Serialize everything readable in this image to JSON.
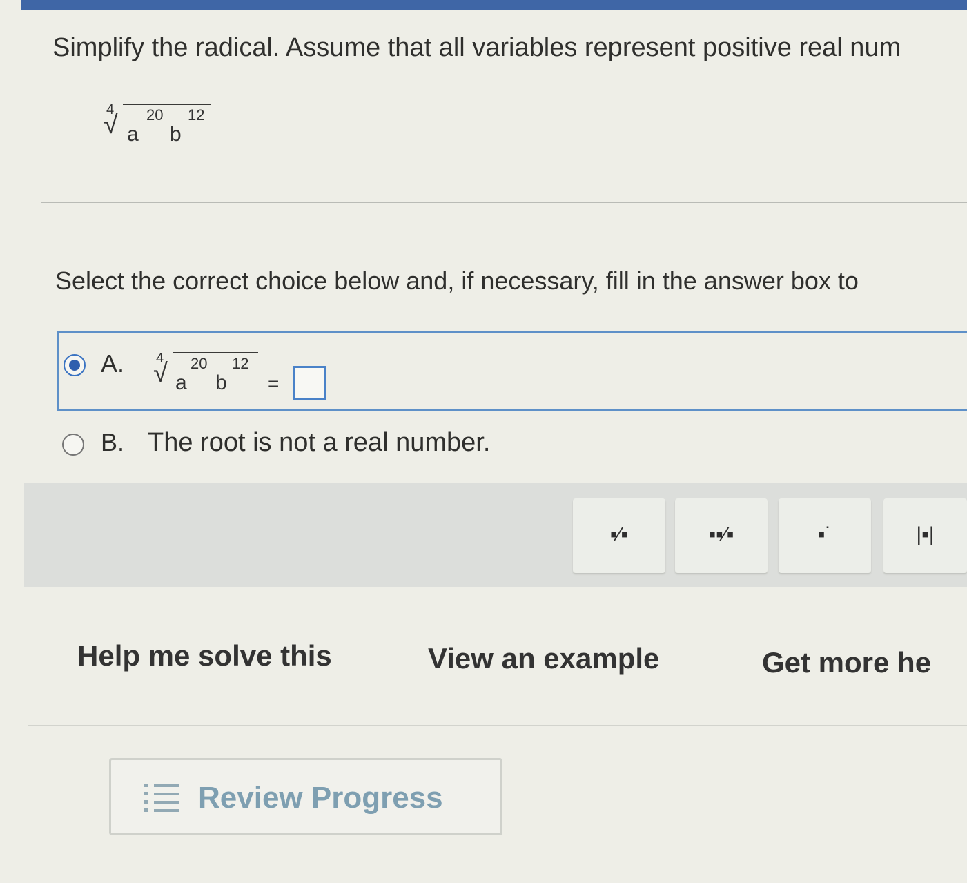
{
  "question": {
    "text": "Simplify the radical. Assume that all variables represent positive real num",
    "radical": {
      "index": "4",
      "base1": "a",
      "exp1": "20",
      "base2": "b",
      "exp2": "12"
    }
  },
  "instruction": "Select the correct choice below and, if necessary, fill in the answer box to",
  "choices": [
    {
      "letter": "A.",
      "selected": true,
      "equals": "=",
      "answer_value": ""
    },
    {
      "letter": "B.",
      "text": "The root is not a real number.",
      "selected": false
    }
  ],
  "toolbar": {
    "buttons": [
      {
        "icon": "fraction-icon",
        "glyph": "▪⁄▪"
      },
      {
        "icon": "mixed-number-icon",
        "glyph": "▪▪⁄▪"
      },
      {
        "icon": "exponent-icon",
        "glyph": "▪˙"
      },
      {
        "icon": "absolute-value-icon",
        "glyph": "|▪|"
      }
    ]
  },
  "help_links": {
    "help": "Help me solve this",
    "example": "View an example",
    "more": "Get more he"
  },
  "review": {
    "label": "Review Progress",
    "icon": "list-icon"
  },
  "colors": {
    "accent": "#3f66a6",
    "selected_border": "#5e90c8",
    "radio_dot": "#2f5fae",
    "review_text": "#7e9fb1"
  }
}
